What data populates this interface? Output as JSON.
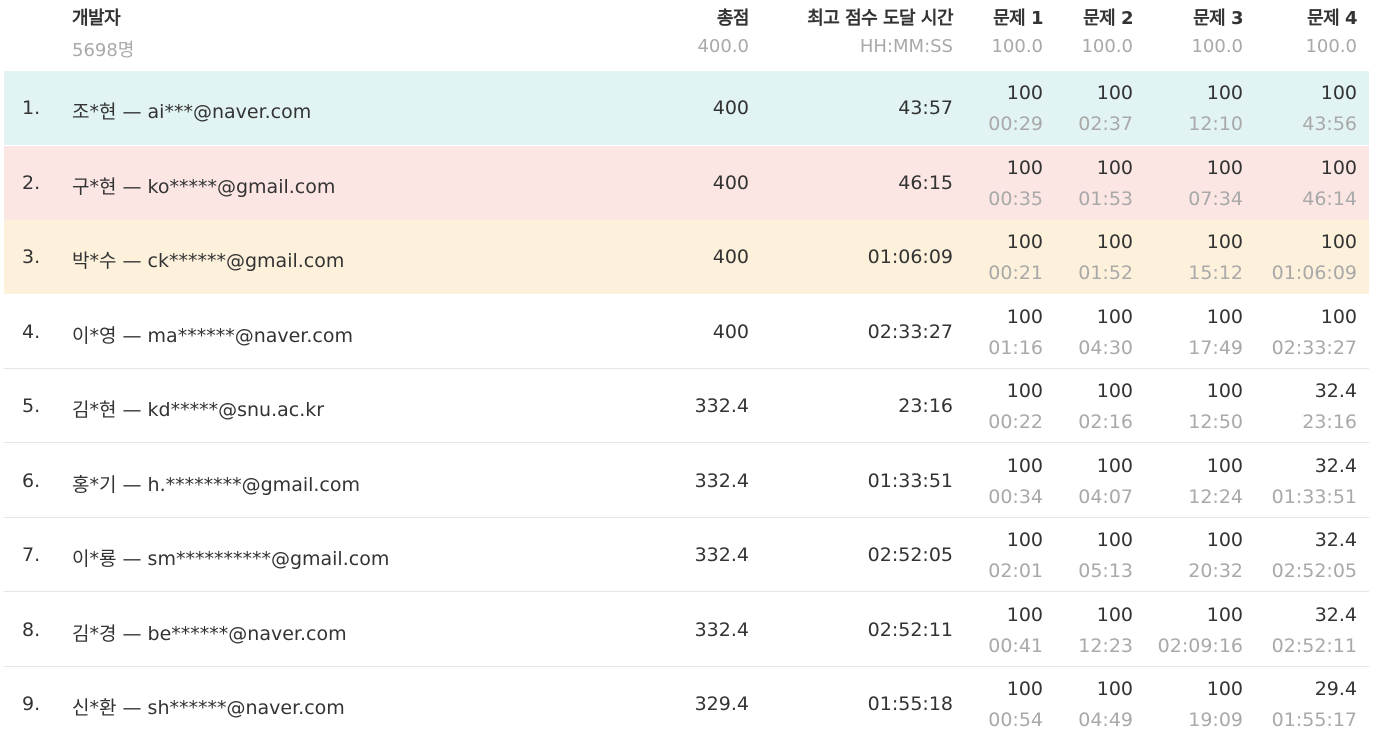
{
  "header": {
    "developer_label": "개발자",
    "developer_count": "5698명",
    "total_label": "총점",
    "total_max": "400.0",
    "time_label": "최고 점수 도달 시간",
    "time_format": "HH:MM:SS",
    "problems": [
      {
        "label": "문제 1",
        "max": "100.0"
      },
      {
        "label": "문제 2",
        "max": "100.0"
      },
      {
        "label": "문제 3",
        "max": "100.0"
      },
      {
        "label": "문제 4",
        "max": "100.0"
      }
    ]
  },
  "colors": {
    "rank1_bg": "#e1f3f3",
    "rank2_bg": "#fbe6e4",
    "rank3_bg": "#fdf1dc",
    "text": "#333333",
    "muted": "#a9a9a9"
  },
  "rows": [
    {
      "rank": "1.",
      "name": "조*현 — ai***@naver.com",
      "total": "400",
      "time": "43:57",
      "problems": [
        {
          "score": "100",
          "time": "00:29"
        },
        {
          "score": "100",
          "time": "02:37"
        },
        {
          "score": "100",
          "time": "12:10"
        },
        {
          "score": "100",
          "time": "43:56"
        }
      ]
    },
    {
      "rank": "2.",
      "name": "구*현 — ko*****@gmail.com",
      "total": "400",
      "time": "46:15",
      "problems": [
        {
          "score": "100",
          "time": "00:35"
        },
        {
          "score": "100",
          "time": "01:53"
        },
        {
          "score": "100",
          "time": "07:34"
        },
        {
          "score": "100",
          "time": "46:14"
        }
      ]
    },
    {
      "rank": "3.",
      "name": "박*수 — ck******@gmail.com",
      "total": "400",
      "time": "01:06:09",
      "problems": [
        {
          "score": "100",
          "time": "00:21"
        },
        {
          "score": "100",
          "time": "01:52"
        },
        {
          "score": "100",
          "time": "15:12"
        },
        {
          "score": "100",
          "time": "01:06:09"
        }
      ]
    },
    {
      "rank": "4.",
      "name": "이*영 — ma******@naver.com",
      "total": "400",
      "time": "02:33:27",
      "problems": [
        {
          "score": "100",
          "time": "01:16"
        },
        {
          "score": "100",
          "time": "04:30"
        },
        {
          "score": "100",
          "time": "17:49"
        },
        {
          "score": "100",
          "time": "02:33:27"
        }
      ]
    },
    {
      "rank": "5.",
      "name": "김*현 — kd*****@snu.ac.kr",
      "total": "332.4",
      "time": "23:16",
      "problems": [
        {
          "score": "100",
          "time": "00:22"
        },
        {
          "score": "100",
          "time": "02:16"
        },
        {
          "score": "100",
          "time": "12:50"
        },
        {
          "score": "32.4",
          "time": "23:16"
        }
      ]
    },
    {
      "rank": "6.",
      "name": "홍*기 — h.********@gmail.com",
      "total": "332.4",
      "time": "01:33:51",
      "problems": [
        {
          "score": "100",
          "time": "00:34"
        },
        {
          "score": "100",
          "time": "04:07"
        },
        {
          "score": "100",
          "time": "12:24"
        },
        {
          "score": "32.4",
          "time": "01:33:51"
        }
      ]
    },
    {
      "rank": "7.",
      "name": "이*룡 — sm**********@gmail.com",
      "total": "332.4",
      "time": "02:52:05",
      "problems": [
        {
          "score": "100",
          "time": "02:01"
        },
        {
          "score": "100",
          "time": "05:13"
        },
        {
          "score": "100",
          "time": "20:32"
        },
        {
          "score": "32.4",
          "time": "02:52:05"
        }
      ]
    },
    {
      "rank": "8.",
      "name": "김*경 — be******@naver.com",
      "total": "332.4",
      "time": "02:52:11",
      "problems": [
        {
          "score": "100",
          "time": "00:41"
        },
        {
          "score": "100",
          "time": "12:23"
        },
        {
          "score": "100",
          "time": "02:09:16"
        },
        {
          "score": "32.4",
          "time": "02:52:11"
        }
      ]
    },
    {
      "rank": "9.",
      "name": "신*환 — sh******@naver.com",
      "total": "329.4",
      "time": "01:55:18",
      "problems": [
        {
          "score": "100",
          "time": "00:54"
        },
        {
          "score": "100",
          "time": "04:49"
        },
        {
          "score": "100",
          "time": "19:09"
        },
        {
          "score": "29.4",
          "time": "01:55:17"
        }
      ]
    }
  ]
}
